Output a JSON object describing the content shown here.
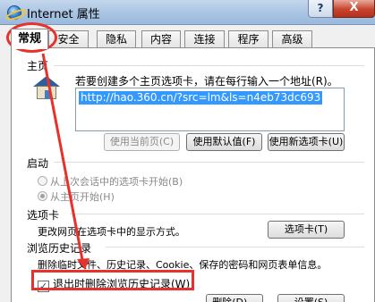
{
  "window": {
    "title": "Internet 属性",
    "help_label": "?",
    "close_label": "X"
  },
  "tabs": [
    {
      "label": "常规",
      "active": true
    },
    {
      "label": "安全"
    },
    {
      "label": "隐私"
    },
    {
      "label": "内容"
    },
    {
      "label": "连接"
    },
    {
      "label": "程序"
    },
    {
      "label": "高级"
    }
  ],
  "homepage": {
    "group_label": "主页",
    "instruction": "若要创建多个主页选项卡，请在每行输入一个地址(R)。",
    "url": "http://hao.360.cn/?src=lm&ls=n4eb73dc693",
    "use_current_label": "使用当前页(C)",
    "use_default_label": "使用默认值(F)",
    "use_new_tab_label": "使用新选项卡(U)"
  },
  "startup": {
    "group_label": "启动",
    "option_last_session": "从上次会话中的选项卡开始(B)",
    "option_homepage": "从主页开始(H)"
  },
  "tabs_section": {
    "group_label": "选项卡",
    "description": "更改网页在选项卡中的显示方式。",
    "button_label": "选项卡(T)"
  },
  "history": {
    "group_label": "浏览历史记录",
    "description": "删除临时文件、历史记录、Cookie、保存的密码和网页表单信息。",
    "checkbox_label": "退出时删除浏览历史记录(W)",
    "checkbox_checked": true,
    "delete_label": "删除(D)...",
    "settings_label": "设置(S)"
  },
  "colors": {
    "annotation": "#e8312a",
    "selection": "#3399ff"
  }
}
